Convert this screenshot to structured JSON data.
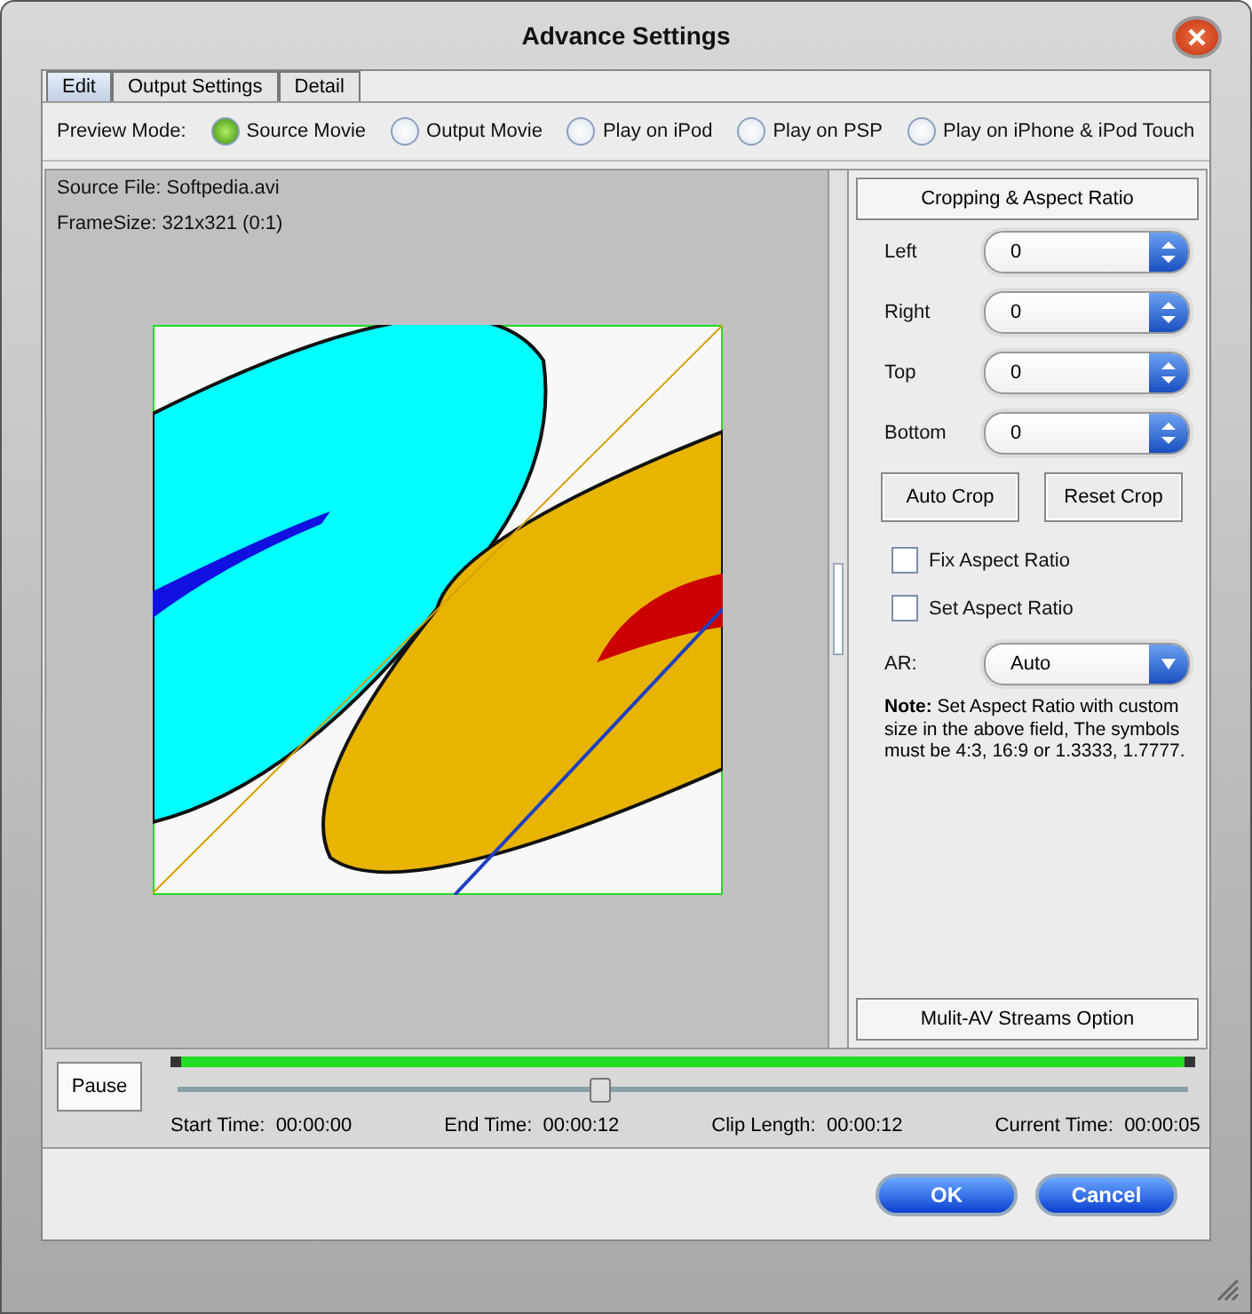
{
  "window": {
    "title": "Advance Settings"
  },
  "tabs": [
    {
      "label": "Edit",
      "selected": true
    },
    {
      "label": "Output Settings",
      "selected": false
    },
    {
      "label": "Detail",
      "selected": false
    }
  ],
  "preview_mode": {
    "label": "Preview Mode:",
    "options": [
      {
        "label": "Source Movie",
        "selected": true
      },
      {
        "label": "Output Movie",
        "selected": false
      },
      {
        "label": "Play on iPod",
        "selected": false
      },
      {
        "label": "Play on PSP",
        "selected": false
      },
      {
        "label": "Play on iPhone & iPod Touch",
        "selected": false
      }
    ]
  },
  "preview": {
    "source_file": "Source File: Softpedia.avi",
    "frame_size": "FrameSize: 321x321 (0:1)"
  },
  "cropping": {
    "title": "Cropping & Aspect Ratio",
    "fields": [
      {
        "label": "Left",
        "value": "0"
      },
      {
        "label": "Right",
        "value": "0"
      },
      {
        "label": "Top",
        "value": "0"
      },
      {
        "label": "Bottom",
        "value": "0"
      }
    ],
    "buttons": [
      "Auto Crop",
      "Reset Crop"
    ],
    "checkboxes": [
      {
        "label": "Fix Aspect Ratio",
        "checked": false
      },
      {
        "label": "Set Aspect Ratio",
        "checked": false
      }
    ],
    "ar": {
      "label": "AR:",
      "value": "Auto"
    },
    "note": "**Note:** Set Aspect Ratio with custom size in the above field, The symbols must be 4:3, 16:9 or 1.3333, 1.7777."
  },
  "streams_button": "Mulit-AV Streams Option",
  "playback": {
    "pause": "Pause",
    "level": 0.417,
    "times": [
      {
        "label": "Start Time:",
        "value": "00:00:00"
      },
      {
        "label": "End Time:",
        "value": "00:00:12"
      },
      {
        "label": "Clip Length:",
        "value": "00:00:12"
      },
      {
        "label": "Current Time:",
        "value": "00:00:05"
      }
    ]
  },
  "buttons": [
    "OK",
    "Cancel"
  ]
}
